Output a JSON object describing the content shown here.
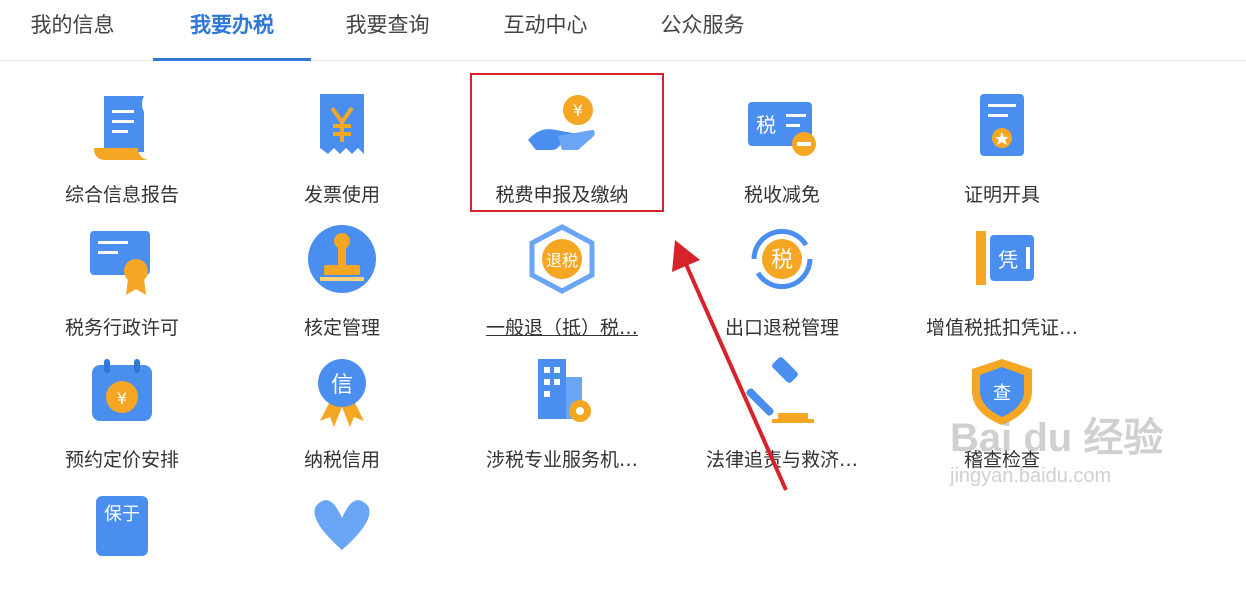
{
  "tabs": [
    {
      "label": "我的信息",
      "active": false
    },
    {
      "label": "我要办税",
      "active": true
    },
    {
      "label": "我要查询",
      "active": false
    },
    {
      "label": "互动中心",
      "active": false
    },
    {
      "label": "公众服务",
      "active": false
    }
  ],
  "tiles": [
    {
      "label": "综合信息报告",
      "icon": "document-report-icon"
    },
    {
      "label": "发票使用",
      "icon": "invoice-yuan-icon"
    },
    {
      "label": "税费申报及缴纳",
      "icon": "hand-coin-icon"
    },
    {
      "label": "税收减免",
      "icon": "tax-card-minus-icon"
    },
    {
      "label": "证明开具",
      "icon": "certificate-star-icon"
    },
    {
      "label": "税务行政许可",
      "icon": "license-ribbon-icon"
    },
    {
      "label": "核定管理",
      "icon": "stamp-icon"
    },
    {
      "label": "一般退（抵）税…",
      "icon": "tax-refund-hexagon-icon"
    },
    {
      "label": "出口退税管理",
      "icon": "export-refund-icon"
    },
    {
      "label": "增值税抵扣凭证…",
      "icon": "voucher-ticket-icon"
    },
    {
      "label": "预约定价安排",
      "icon": "calendar-yuan-icon"
    },
    {
      "label": "纳税信用",
      "icon": "credit-medal-icon"
    },
    {
      "label": "涉税专业服务机…",
      "icon": "building-gear-icon"
    },
    {
      "label": "法律追责与救济…",
      "icon": "gavel-icon"
    },
    {
      "label": "稽查检查",
      "icon": "inspection-shield-icon"
    },
    {
      "label": "",
      "icon": "cert-partial-icon"
    },
    {
      "label": "",
      "icon": "heart-partial-icon"
    }
  ],
  "partial_tile_text": "保于",
  "highlighted_tile": "税费申报及缴纳",
  "watermark": {
    "brand": "Bai du 经验",
    "url": "jingyan.baidu.com"
  },
  "colors": {
    "accent": "#2f78d6",
    "highlight": "#d6222a",
    "icon_blue": "#4a8ff0",
    "icon_orange": "#f5a623"
  }
}
